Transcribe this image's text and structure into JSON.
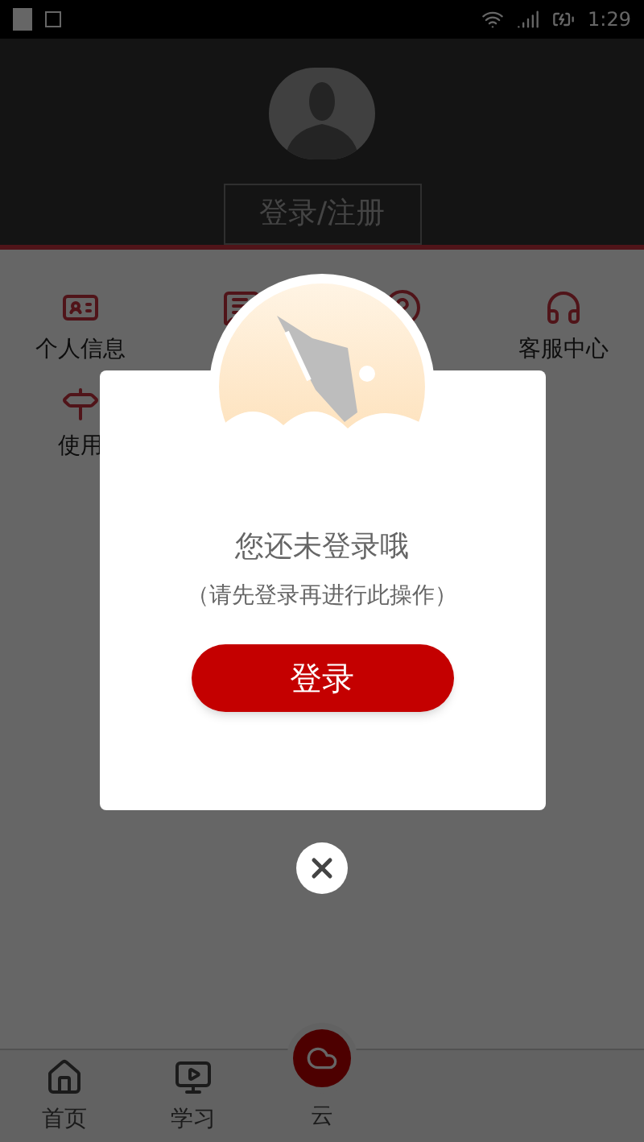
{
  "status_bar": {
    "time": "1:29"
  },
  "profile": {
    "login_button": "登录/注册"
  },
  "menu": [
    {
      "kind": "id-card",
      "label": "个人信息"
    },
    {
      "kind": "message"
    },
    {
      "kind": "question"
    },
    {
      "kind": "headset",
      "label": "客服中心"
    },
    {
      "kind": "guide",
      "label": "使用"
    }
  ],
  "tab_bar": [
    {
      "kind": "home",
      "label": "首页"
    },
    {
      "kind": "video",
      "label": "学习"
    },
    {
      "kind": "center",
      "label": "云"
    }
  ],
  "dialog": {
    "title": "您还未登录哦",
    "message": "（请先登录再进行此操作）",
    "button": "登录"
  }
}
